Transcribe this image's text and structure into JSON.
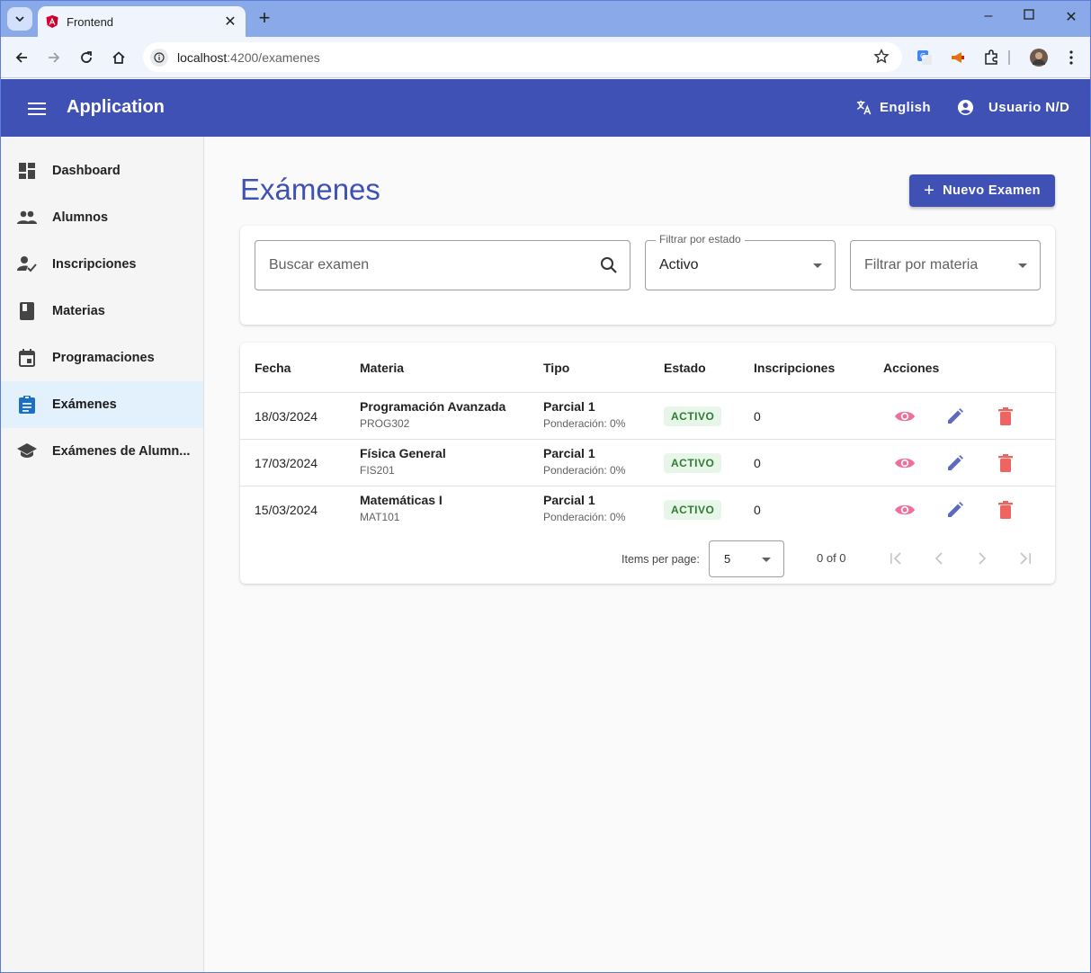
{
  "browser": {
    "tab_title": "Frontend",
    "url_host": "localhost",
    "url_rest": ":4200/examenes"
  },
  "app": {
    "title": "Application",
    "language": "English",
    "user": "Usuario N/D"
  },
  "sidebar": {
    "items": [
      {
        "label": "Dashboard",
        "icon": "dashboard-icon"
      },
      {
        "label": "Alumnos",
        "icon": "people-icon"
      },
      {
        "label": "Inscripciones",
        "icon": "how-to-reg-icon"
      },
      {
        "label": "Materias",
        "icon": "book-icon"
      },
      {
        "label": "Programaciones",
        "icon": "calendar-icon"
      },
      {
        "label": "Exámenes",
        "icon": "assignment-icon",
        "active": true
      },
      {
        "label": "Exámenes de Alumn...",
        "icon": "school-icon"
      }
    ]
  },
  "page": {
    "title": "Exámenes",
    "new_button": "Nuevo Examen"
  },
  "filters": {
    "search_placeholder": "Buscar examen",
    "estado_label": "Filtrar por estado",
    "estado_value": "Activo",
    "materia_placeholder": "Filtrar por materia"
  },
  "table": {
    "headers": {
      "fecha": "Fecha",
      "materia": "Materia",
      "tipo": "Tipo",
      "estado": "Estado",
      "inscripciones": "Inscripciones",
      "acciones": "Acciones"
    },
    "rows": [
      {
        "fecha": "18/03/2024",
        "materia": "Programación Avanzada",
        "codigo": "PROG302",
        "tipo": "Parcial 1",
        "ponderacion": "Ponderación: 0%",
        "estado": "ACTIVO",
        "inscripciones": "0"
      },
      {
        "fecha": "17/03/2024",
        "materia": "Física General",
        "codigo": "FIS201",
        "tipo": "Parcial 1",
        "ponderacion": "Ponderación: 0%",
        "estado": "ACTIVO",
        "inscripciones": "0"
      },
      {
        "fecha": "15/03/2024",
        "materia": "Matemáticas I",
        "codigo": "MAT101",
        "tipo": "Parcial 1",
        "ponderacion": "Ponderación: 0%",
        "estado": "ACTIVO",
        "inscripciones": "0"
      }
    ]
  },
  "paginator": {
    "items_per_page_label": "Items per page:",
    "page_size": "5",
    "range": "0 of 0"
  },
  "colors": {
    "primary": "#3f51b5",
    "view_icon": "#ec6f9d",
    "edit_icon": "#5c6bc0",
    "delete_icon": "#ef6461",
    "badge_bg": "#e8f5e9",
    "badge_text": "#2e7d32"
  }
}
